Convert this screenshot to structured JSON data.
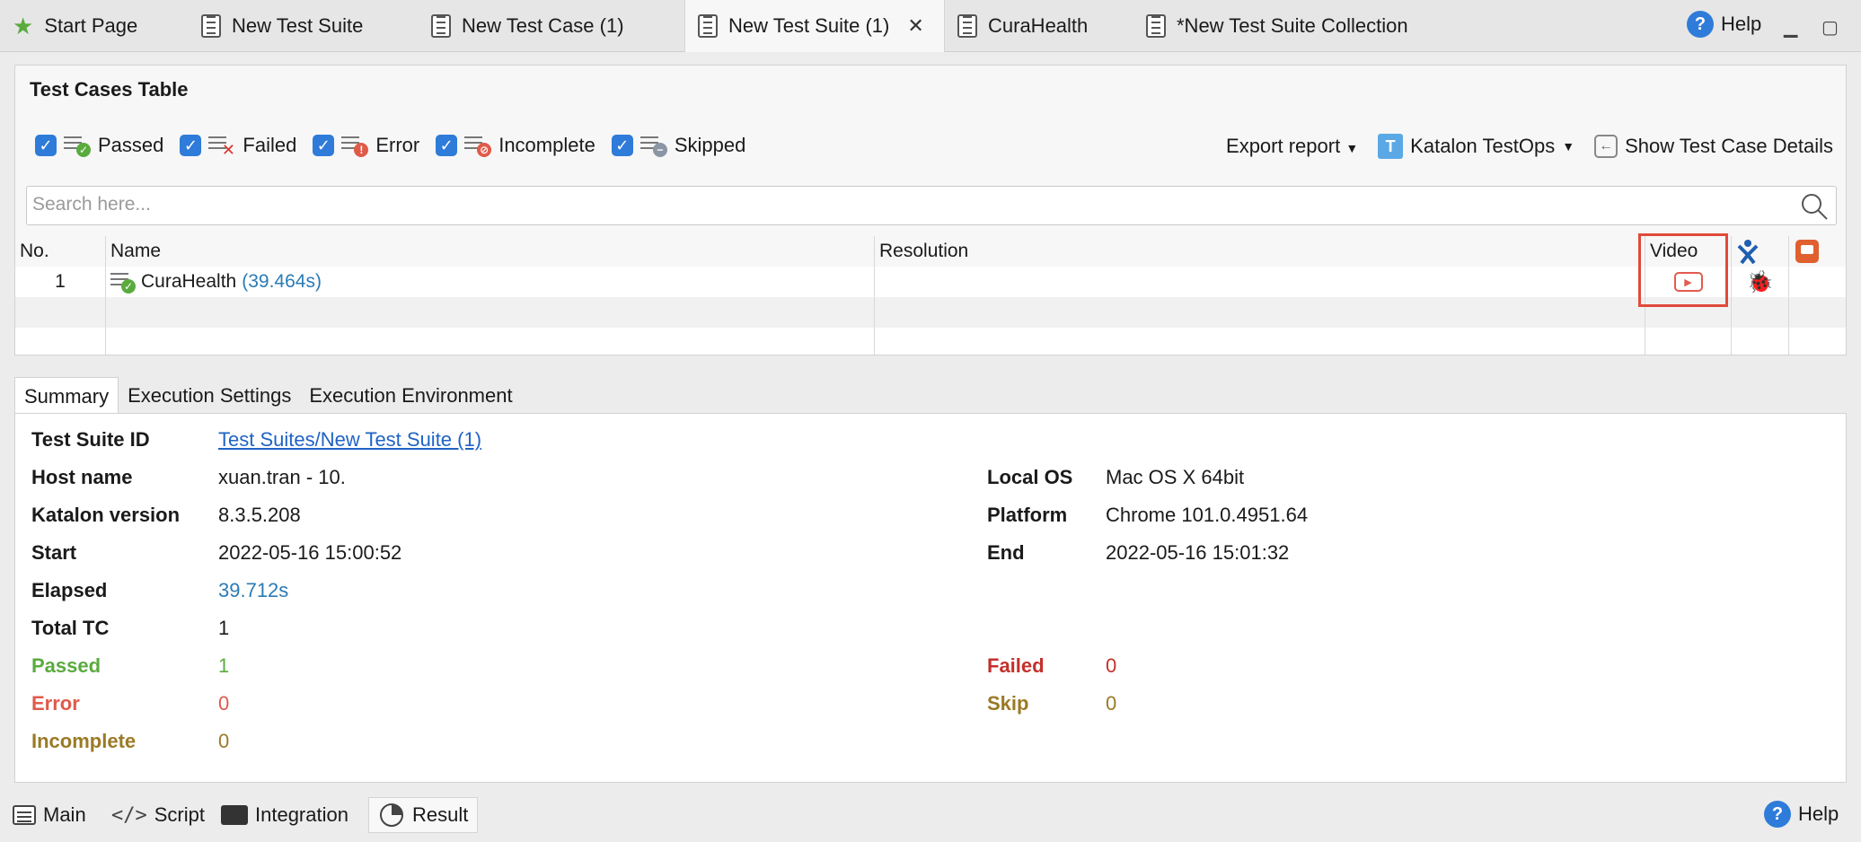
{
  "tabs": [
    {
      "label": "Start Page"
    },
    {
      "label": "New Test Suite"
    },
    {
      "label": "New Test Case (1)"
    },
    {
      "label": "New Test Suite (1)"
    },
    {
      "label": "CuraHealth"
    },
    {
      "label": "*New Test Suite Collection"
    }
  ],
  "help_label": "Help",
  "panel": {
    "title": "Test Cases Table",
    "filters": [
      {
        "label": "Passed",
        "checked": true,
        "badge_color": "#5aab3e"
      },
      {
        "label": "Failed",
        "checked": true,
        "badge_color": "#d9342b"
      },
      {
        "label": "Error",
        "checked": true,
        "badge_color": "#e05a4a"
      },
      {
        "label": "Incomplete",
        "checked": true,
        "badge_color": "#e05a4a"
      },
      {
        "label": "Skipped",
        "checked": true,
        "badge_color": "#8a96a6"
      }
    ],
    "export_label": "Export report",
    "testops_label": "Katalon TestOps",
    "show_details_label": "Show Test Case Details",
    "search_placeholder": "Search here...",
    "columns": {
      "no": "No.",
      "name": "Name",
      "resolution": "Resolution",
      "video": "Video"
    },
    "rows": [
      {
        "no": "1",
        "name": "CuraHealth",
        "duration": "(39.464s)",
        "resolution": ""
      }
    ]
  },
  "subtabs": [
    "Summary",
    "Execution Settings",
    "Execution Environment"
  ],
  "summary": {
    "test_suite_id_label": "Test Suite ID",
    "test_suite_id": "Test Suites/New Test Suite (1)",
    "host_name_label": "Host name",
    "host_name": "xuan.tran - 10.",
    "katalon_version_label": "Katalon version",
    "katalon_version": "8.3.5.208",
    "start_label": "Start",
    "start": "2022-05-16 15:00:52",
    "elapsed_label": "Elapsed",
    "elapsed": "39.712s",
    "total_tc_label": "Total TC",
    "total_tc": "1",
    "passed_label": "Passed",
    "passed": "1",
    "error_label": "Error",
    "error": "0",
    "incomplete_label": "Incomplete",
    "incomplete": "0",
    "local_os_label": "Local OS",
    "local_os": "Mac OS X 64bit",
    "platform_label": "Platform",
    "platform": "Chrome 101.0.4951.64",
    "end_label": "End",
    "end": "2022-05-16 15:01:32",
    "failed_label": "Failed",
    "failed": "0",
    "skip_label": "Skip",
    "skip": "0"
  },
  "bottom_tabs": [
    {
      "label": "Main"
    },
    {
      "label": "Script"
    },
    {
      "label": "Integration"
    },
    {
      "label": "Result"
    }
  ]
}
